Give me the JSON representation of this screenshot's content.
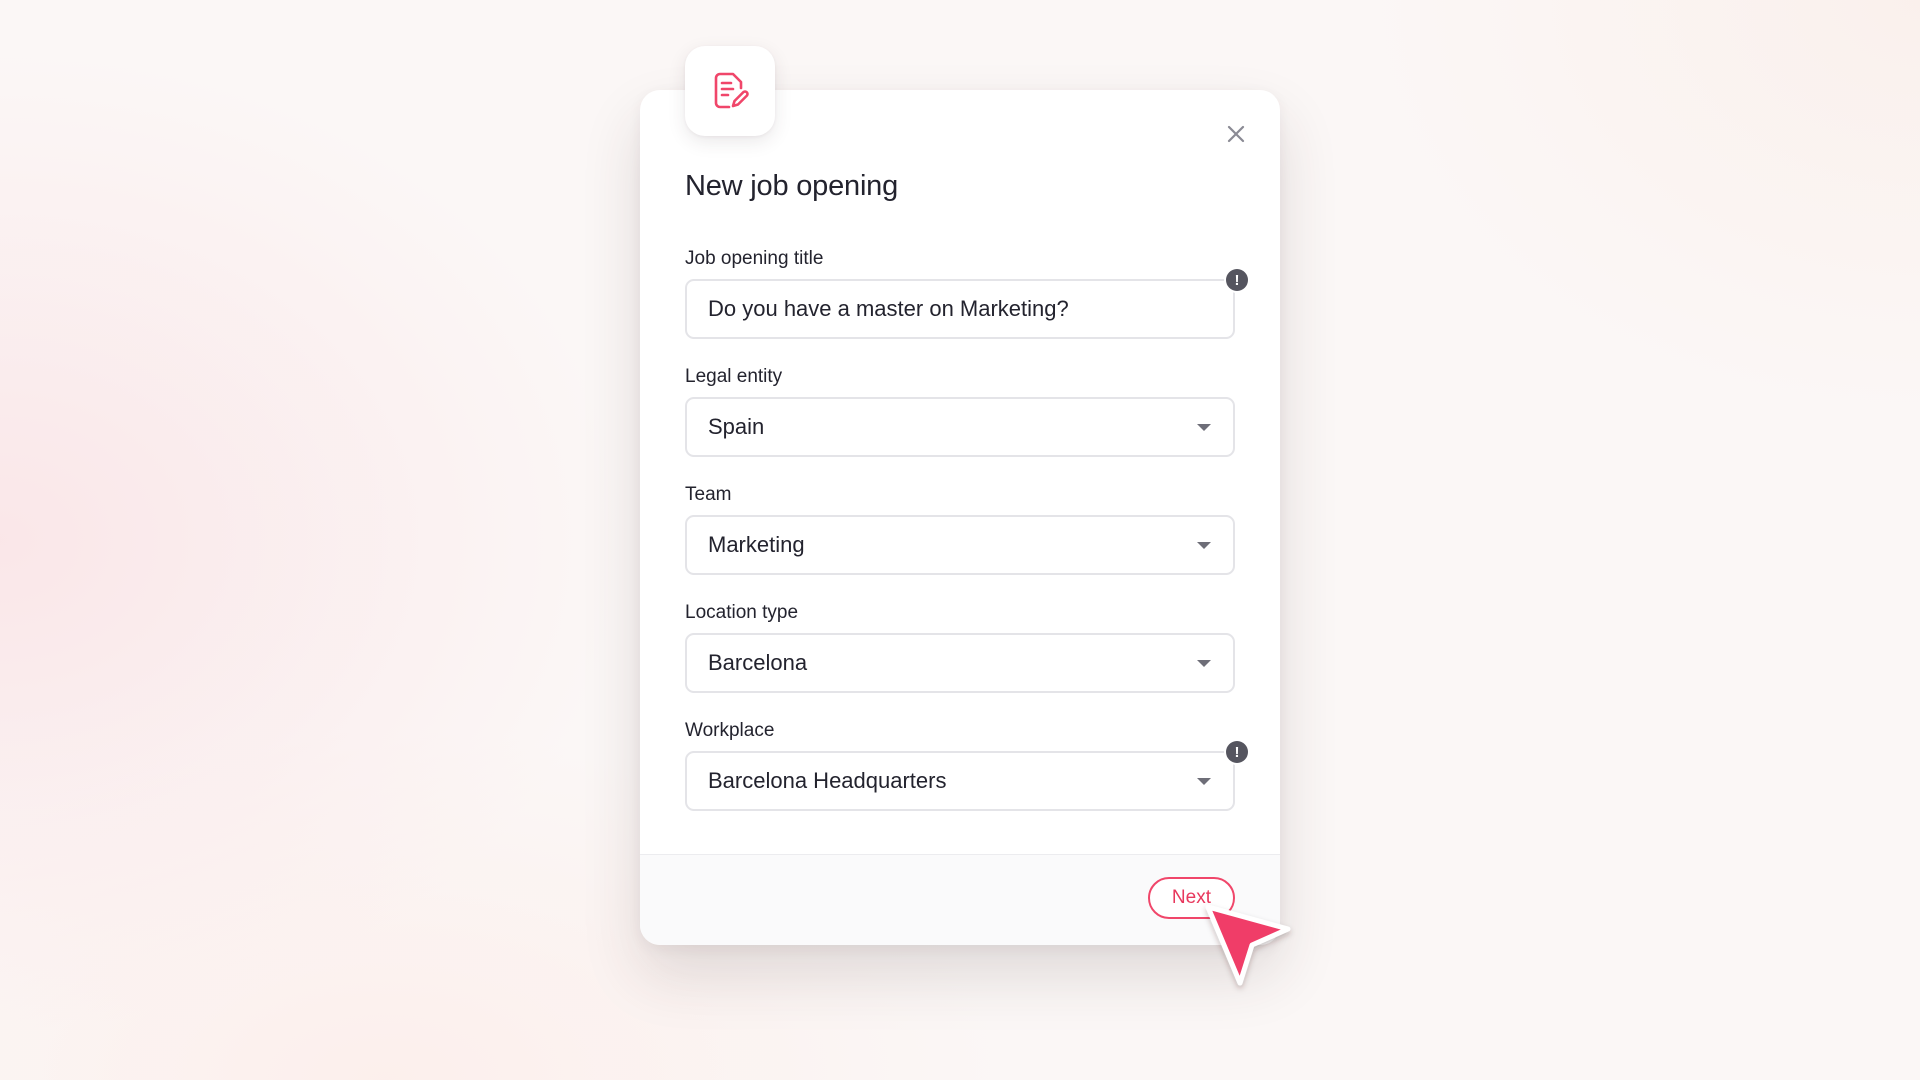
{
  "modal": {
    "title": "New job opening",
    "header_icon": "document-edit-icon",
    "close_icon": "close-icon"
  },
  "fields": {
    "job_title": {
      "label": "Job opening title",
      "value": "Do you have a master on Marketing?",
      "alert_symbol": "!"
    },
    "legal_entity": {
      "label": "Legal entity",
      "value": "Spain"
    },
    "team": {
      "label": "Team",
      "value": "Marketing"
    },
    "location_type": {
      "label": "Location type",
      "value": "Barcelona"
    },
    "workplace": {
      "label": "Workplace",
      "value": "Barcelona Headquarters",
      "alert_symbol": "!"
    }
  },
  "footer": {
    "next_label": "Next"
  },
  "colors": {
    "accent": "#f0466a",
    "text": "#23232e",
    "alert": "#55555f",
    "cursor": "#f03d68"
  }
}
